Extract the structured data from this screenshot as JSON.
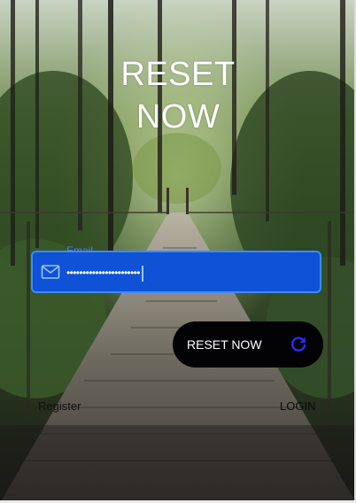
{
  "page": {
    "title_line1": "RESET",
    "title_line2": "NOW"
  },
  "email_field": {
    "label": "Email",
    "value": "•••••••••••••••••••••••",
    "icon": "mail-icon"
  },
  "reset_button": {
    "label": "RESET NOW",
    "icon": "refresh-icon",
    "icon_color": "#2b2bff"
  },
  "links": {
    "register": "Register",
    "login": "LOGIN"
  },
  "colors": {
    "field_background": "#0f52d6",
    "field_border": "#3d8bff",
    "button_background": "#030305"
  }
}
